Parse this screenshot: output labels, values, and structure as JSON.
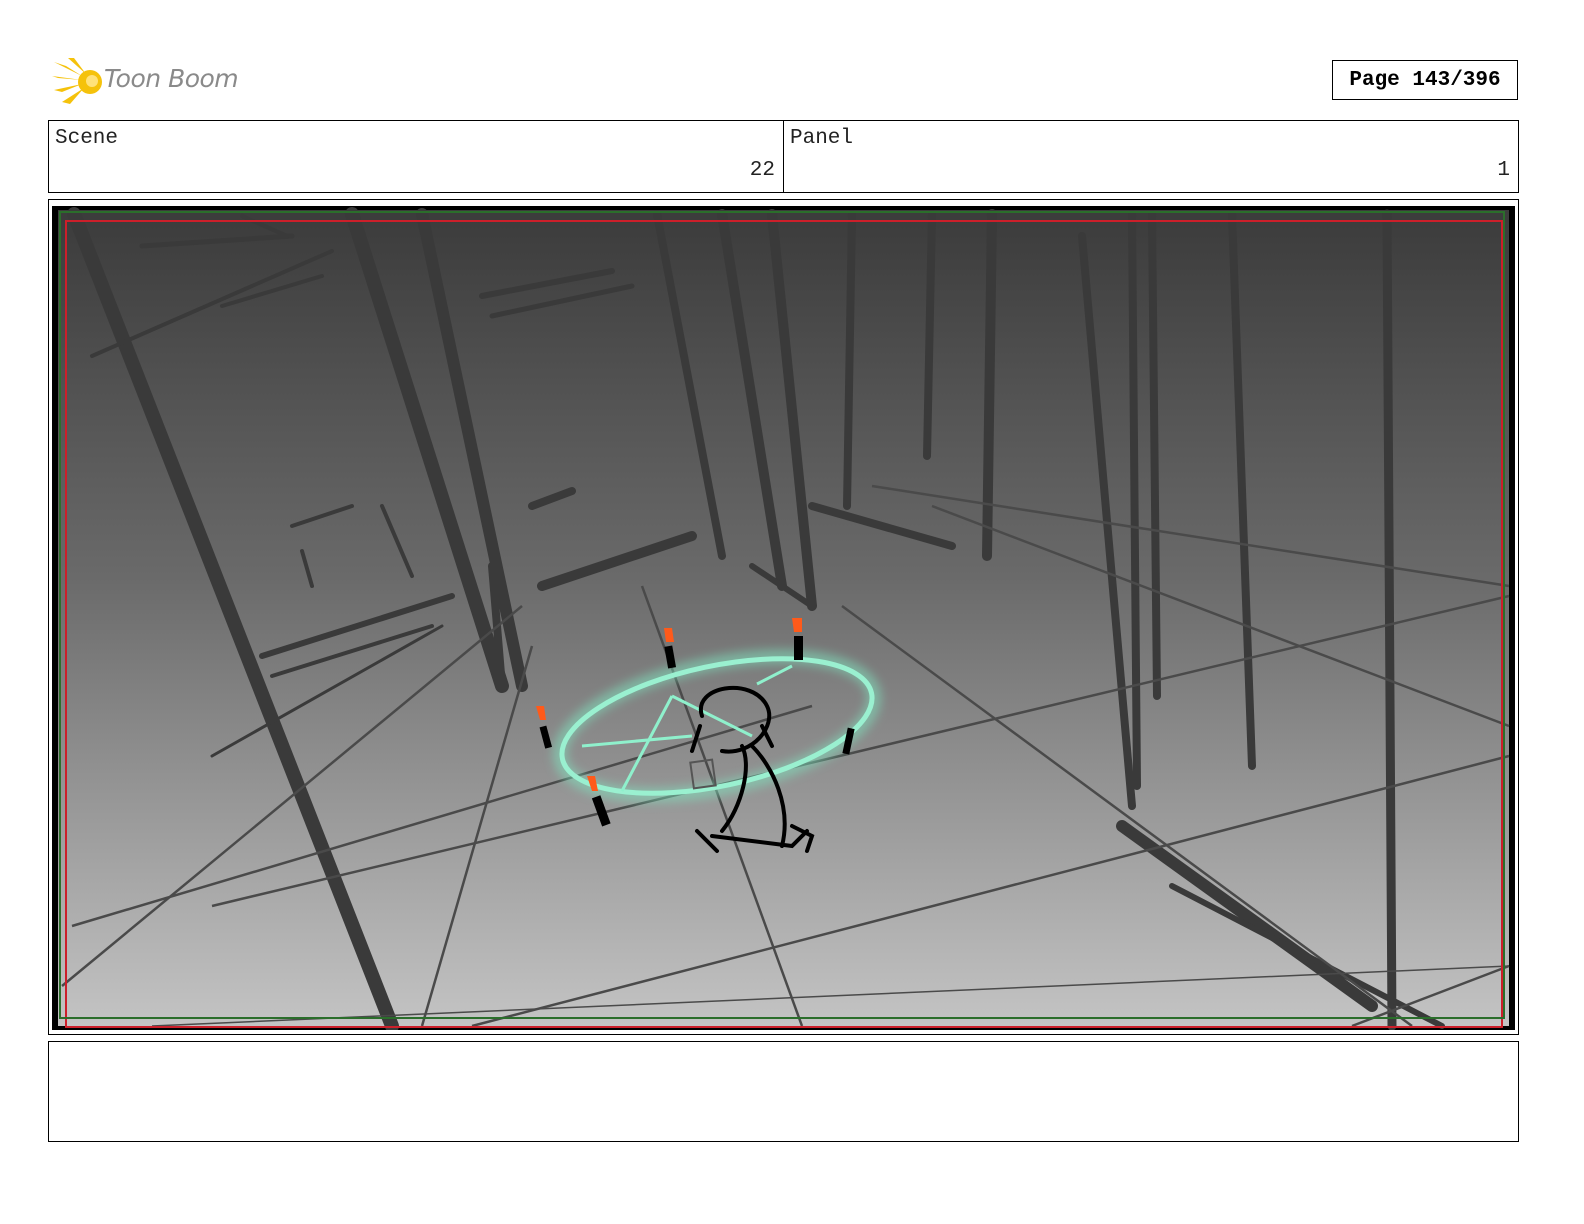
{
  "header": {
    "logo_text": "Toon Boom",
    "page_indicator": "Page 143/396"
  },
  "info": {
    "scene_label": "Scene",
    "scene_value": "22",
    "panel_label": "Panel",
    "panel_value": "1"
  },
  "notes": {
    "text": ""
  },
  "colors": {
    "logo_flame": "#f5c20b",
    "logo_text": "#8a8a8a",
    "safe_frame_red": "#cc1f2a",
    "safe_frame_green": "#2b6e2b",
    "magic_circle": "#7fe6c0",
    "candle_flame": "#ff5a1a"
  }
}
